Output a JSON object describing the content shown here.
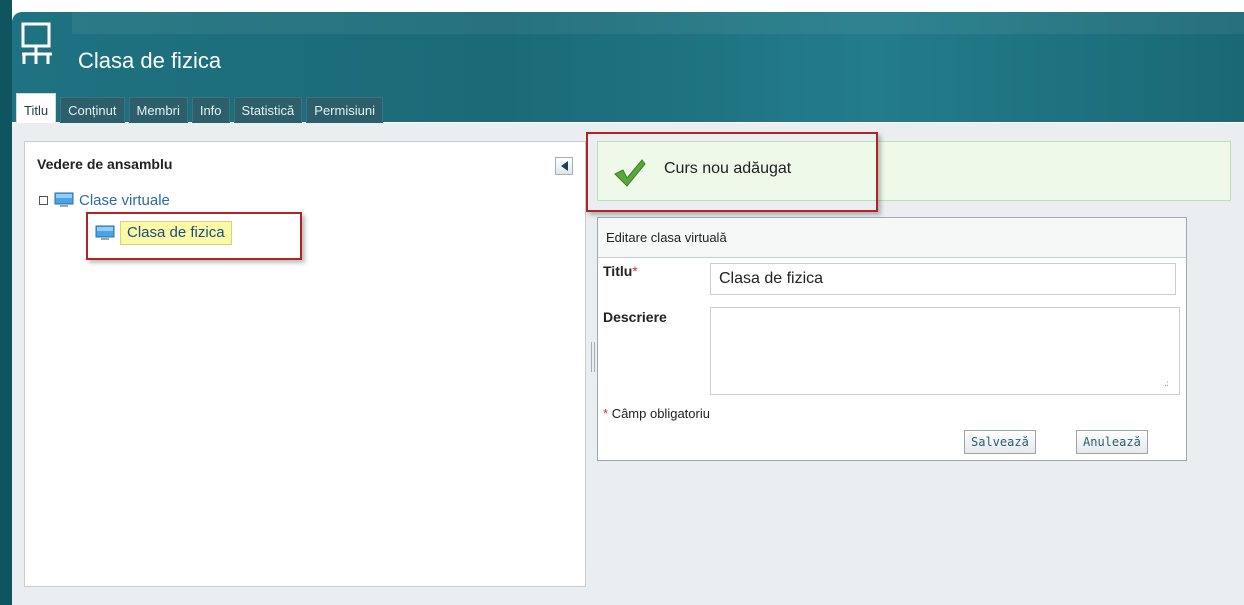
{
  "header": {
    "title": "Clasa de fizica",
    "icon": "classroom-icon"
  },
  "tabs": [
    {
      "label": "Titlu",
      "active": true
    },
    {
      "label": "Conținut",
      "active": false
    },
    {
      "label": "Membri",
      "active": false
    },
    {
      "label": "Info",
      "active": false
    },
    {
      "label": "Statistică",
      "active": false
    },
    {
      "label": "Permisiuni",
      "active": false
    }
  ],
  "left_panel": {
    "title": "Vedere de ansamblu",
    "collapse_icon": "collapse-left-icon",
    "tree": {
      "root_label": "Clase virtuale",
      "child_label": "Clasa de fizica"
    }
  },
  "notification": {
    "text": "Curs nou adăugat",
    "icon": "check-icon"
  },
  "form": {
    "header": "Editare clasa virtuală",
    "title_label": "Titlu",
    "title_value": "Clasa de fizica",
    "description_label": "Descriere",
    "description_value": "",
    "required_marker": "*",
    "required_note": "Câmp obligatoriu",
    "save_label": "Salvează",
    "cancel_label": "Anulează"
  },
  "colors": {
    "header_teal": "#1f7281",
    "highlight_red": "#b02424",
    "success_bg": "#eef9ea",
    "selected_node_bg": "#fbf9a6"
  }
}
